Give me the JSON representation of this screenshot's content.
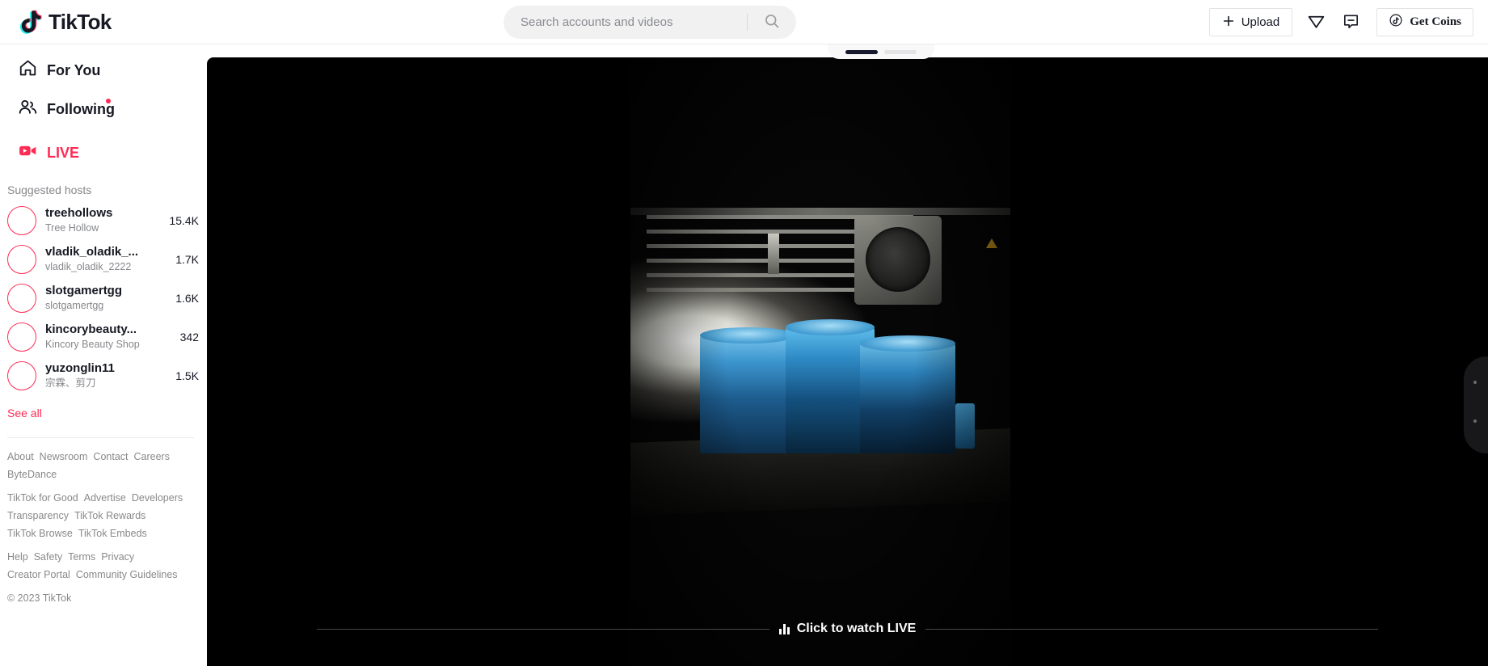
{
  "brand": {
    "name": "TikTok",
    "accent": "#fe2c55",
    "ink": "#161823"
  },
  "header": {
    "search": {
      "placeholder": "Search accounts and videos",
      "value": "",
      "icon": "search-icon"
    },
    "upload": {
      "label": "Upload",
      "icon": "plus-icon"
    },
    "send_icon": "send-icon",
    "message_icon": "message-icon",
    "coins": {
      "label": "Get Coins",
      "icon": "tiktok-note-icon"
    }
  },
  "sidebar": {
    "nav": [
      {
        "label": "For You",
        "icon": "home-icon",
        "active": false,
        "badge": false
      },
      {
        "label": "Following",
        "icon": "people-icon",
        "active": false,
        "badge": true
      },
      {
        "label": "LIVE",
        "icon": "live-video-icon",
        "active": true,
        "badge": false
      }
    ],
    "suggested_title": "Suggested hosts",
    "hosts": [
      {
        "username": "treehollows",
        "display": "Tree Hollow",
        "viewers": "15.4K"
      },
      {
        "username": "vladik_oladik_...",
        "display": "vladik_oladik_2222",
        "viewers": "1.7K"
      },
      {
        "username": "slotgamertgg",
        "display": "slotgamertgg",
        "viewers": "1.6K"
      },
      {
        "username": "kincorybeauty...",
        "display": "Kincory Beauty Shop",
        "viewers": "342"
      },
      {
        "username": "yuzonglin11",
        "display": "宗霖、剪刀",
        "viewers": "1.5K"
      }
    ],
    "see_all": "See all",
    "footer_groups": [
      {
        "links": [
          "About",
          "Newsroom",
          "Contact",
          "Careers",
          "ByteDance"
        ]
      },
      {
        "links": [
          "TikTok for Good",
          "Advertise",
          "Developers",
          "Transparency",
          "TikTok Rewards",
          "TikTok Browse",
          "TikTok Embeds"
        ]
      },
      {
        "links": [
          "Help",
          "Safety",
          "Terms",
          "Privacy",
          "Creator Portal",
          "Community Guidelines"
        ]
      }
    ],
    "copyright": "© 2023 TikTok"
  },
  "main": {
    "progress": {
      "segments": 2,
      "active_index": 0
    },
    "watch_live": {
      "label": "Click to watch LIVE",
      "icon": "audio-bars-icon"
    }
  }
}
